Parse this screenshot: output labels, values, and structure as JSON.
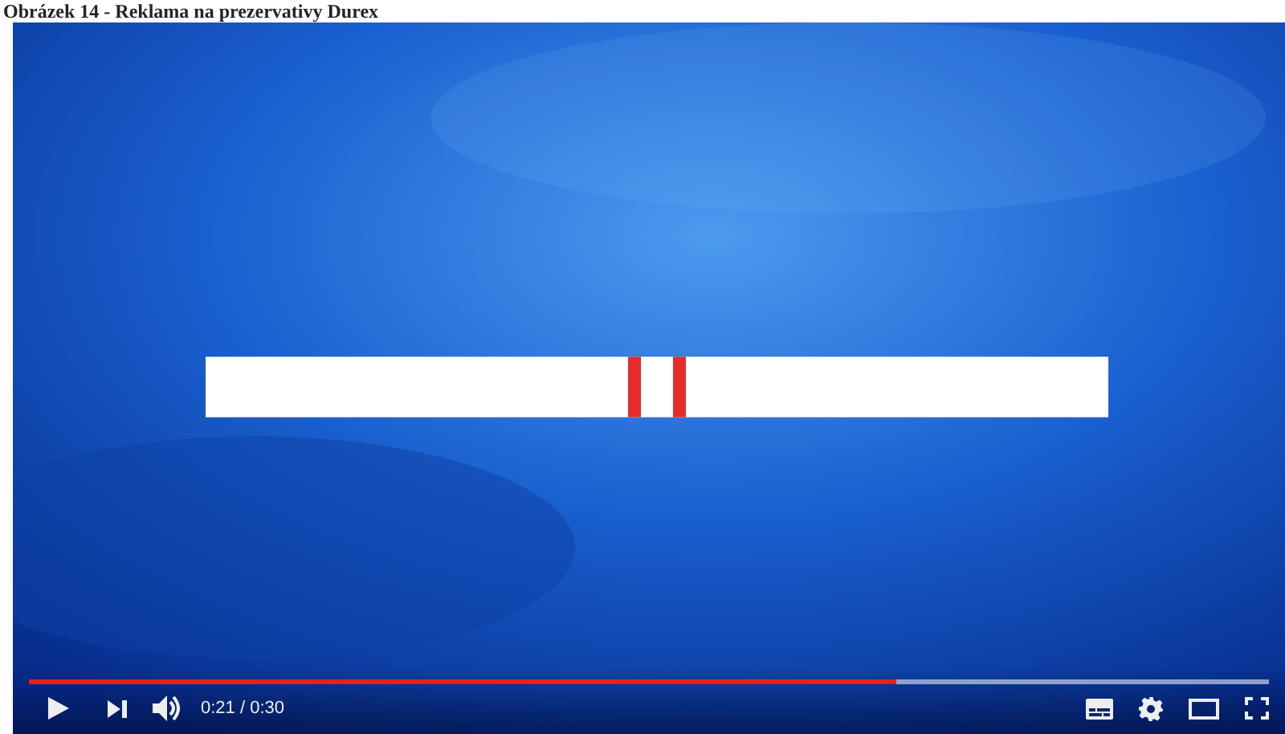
{
  "caption": "Obrázek 14 - Reklama na prezervativy Durex",
  "player": {
    "progress": {
      "level": 0.7
    },
    "time": "0:21 / 0:30"
  }
}
